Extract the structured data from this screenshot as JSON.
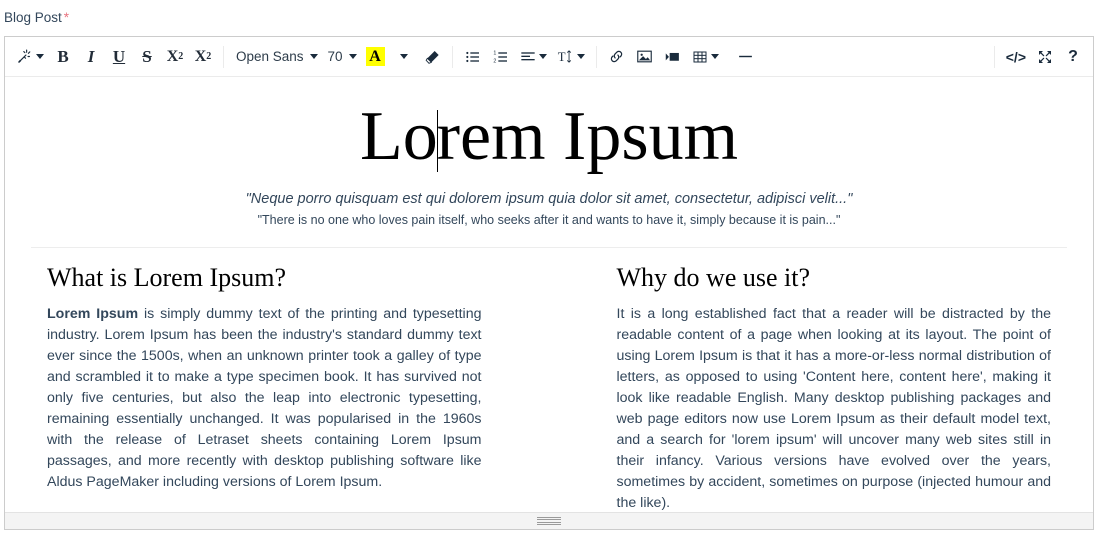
{
  "field": {
    "label": "Blog Post",
    "required_marker": "*"
  },
  "toolbar": {
    "groups": [
      {
        "name": "inline-styles",
        "items": [
          {
            "name": "magic-wand",
            "label": "",
            "icon": "magic-wand-icon",
            "dropdown": true
          },
          {
            "name": "bold",
            "label": "B",
            "icon": "bold-icon"
          },
          {
            "name": "italic",
            "label": "I",
            "icon": "italic-icon"
          },
          {
            "name": "underline",
            "label": "U",
            "icon": "underline-icon"
          },
          {
            "name": "strikethrough",
            "label": "S",
            "icon": "strikethrough-icon"
          },
          {
            "name": "superscript",
            "label": "X",
            "sup": "2",
            "icon": "superscript-icon"
          },
          {
            "name": "subscript",
            "label": "X",
            "sub": "2",
            "icon": "subscript-icon"
          }
        ]
      },
      {
        "name": "font-controls",
        "font_family": "Open Sans",
        "font_size": "70",
        "text_color_letter": "A",
        "text_color_swatch": "#ffff00",
        "eraser": "clear-formatting-icon"
      },
      {
        "name": "paragraph-controls",
        "items": [
          {
            "name": "unordered-list",
            "icon": "bullet-list-icon"
          },
          {
            "name": "ordered-list",
            "icon": "numbered-list-icon"
          },
          {
            "name": "align",
            "icon": "align-left-icon",
            "dropdown": true
          },
          {
            "name": "line-height",
            "icon": "line-height-icon",
            "dropdown": true
          }
        ]
      },
      {
        "name": "insert-controls",
        "items": [
          {
            "name": "insert-link",
            "icon": "link-icon"
          },
          {
            "name": "insert-image",
            "icon": "image-icon"
          },
          {
            "name": "insert-video",
            "icon": "video-icon"
          },
          {
            "name": "insert-table",
            "icon": "table-icon",
            "dropdown": true
          },
          {
            "name": "horizontal-rule",
            "icon": "horizontal-line-icon"
          }
        ]
      },
      {
        "name": "view-controls",
        "items": [
          {
            "name": "code-view",
            "icon": "code-icon",
            "label": "</>"
          },
          {
            "name": "fullscreen",
            "icon": "fullscreen-icon"
          },
          {
            "name": "help",
            "icon": "help-icon",
            "label": "?"
          }
        ]
      }
    ]
  },
  "document": {
    "title": "Lorem Ipsum",
    "title_before_caret": "Lo",
    "title_after_caret": "rem Ipsum",
    "quote_primary": "\"Neque porro quisquam est qui dolorem ipsum quia dolor sit amet, consectetur, adipisci velit...\"",
    "quote_secondary": "\"There is no one who loves pain itself, who seeks after it and wants to have it, simply because it is pain...\"",
    "columns": [
      {
        "heading": "What is Lorem Ipsum?",
        "lead": "Lorem Ipsum",
        "body": " is simply dummy text of the printing and typesetting industry. Lorem Ipsum has been the industry's standard dummy text ever since the 1500s, when an unknown printer took a galley of type and scrambled it to make a type specimen book. It has survived not only five centuries, but also the leap into electronic typesetting, remaining essentially unchanged. It was popularised in the 1960s with the release of Letraset sheets containing Lorem Ipsum passages, and more recently with desktop publishing software like Aldus PageMaker including versions of Lorem Ipsum."
      },
      {
        "heading": "Why do we use it?",
        "lead": "",
        "body": "It is a long established fact that a reader will be distracted by the readable content of a page when looking at its layout. The point of using Lorem Ipsum is that it has a more-or-less normal distribution of letters, as opposed to using 'Content here, content here', making it look like readable English. Many desktop publishing packages and web page editors now use Lorem Ipsum as their default model text, and a search for 'lorem ipsum' will uncover many web sites still in their infancy. Various versions have evolved over the years, sometimes by accident, sometimes on purpose (injected humour and the like)."
      }
    ]
  },
  "colors": {
    "text": "#33475b",
    "required": "#e8737f",
    "highlight": "#ffff00",
    "border": "#cccccc",
    "toolbar_divider": "#ebebeb"
  }
}
